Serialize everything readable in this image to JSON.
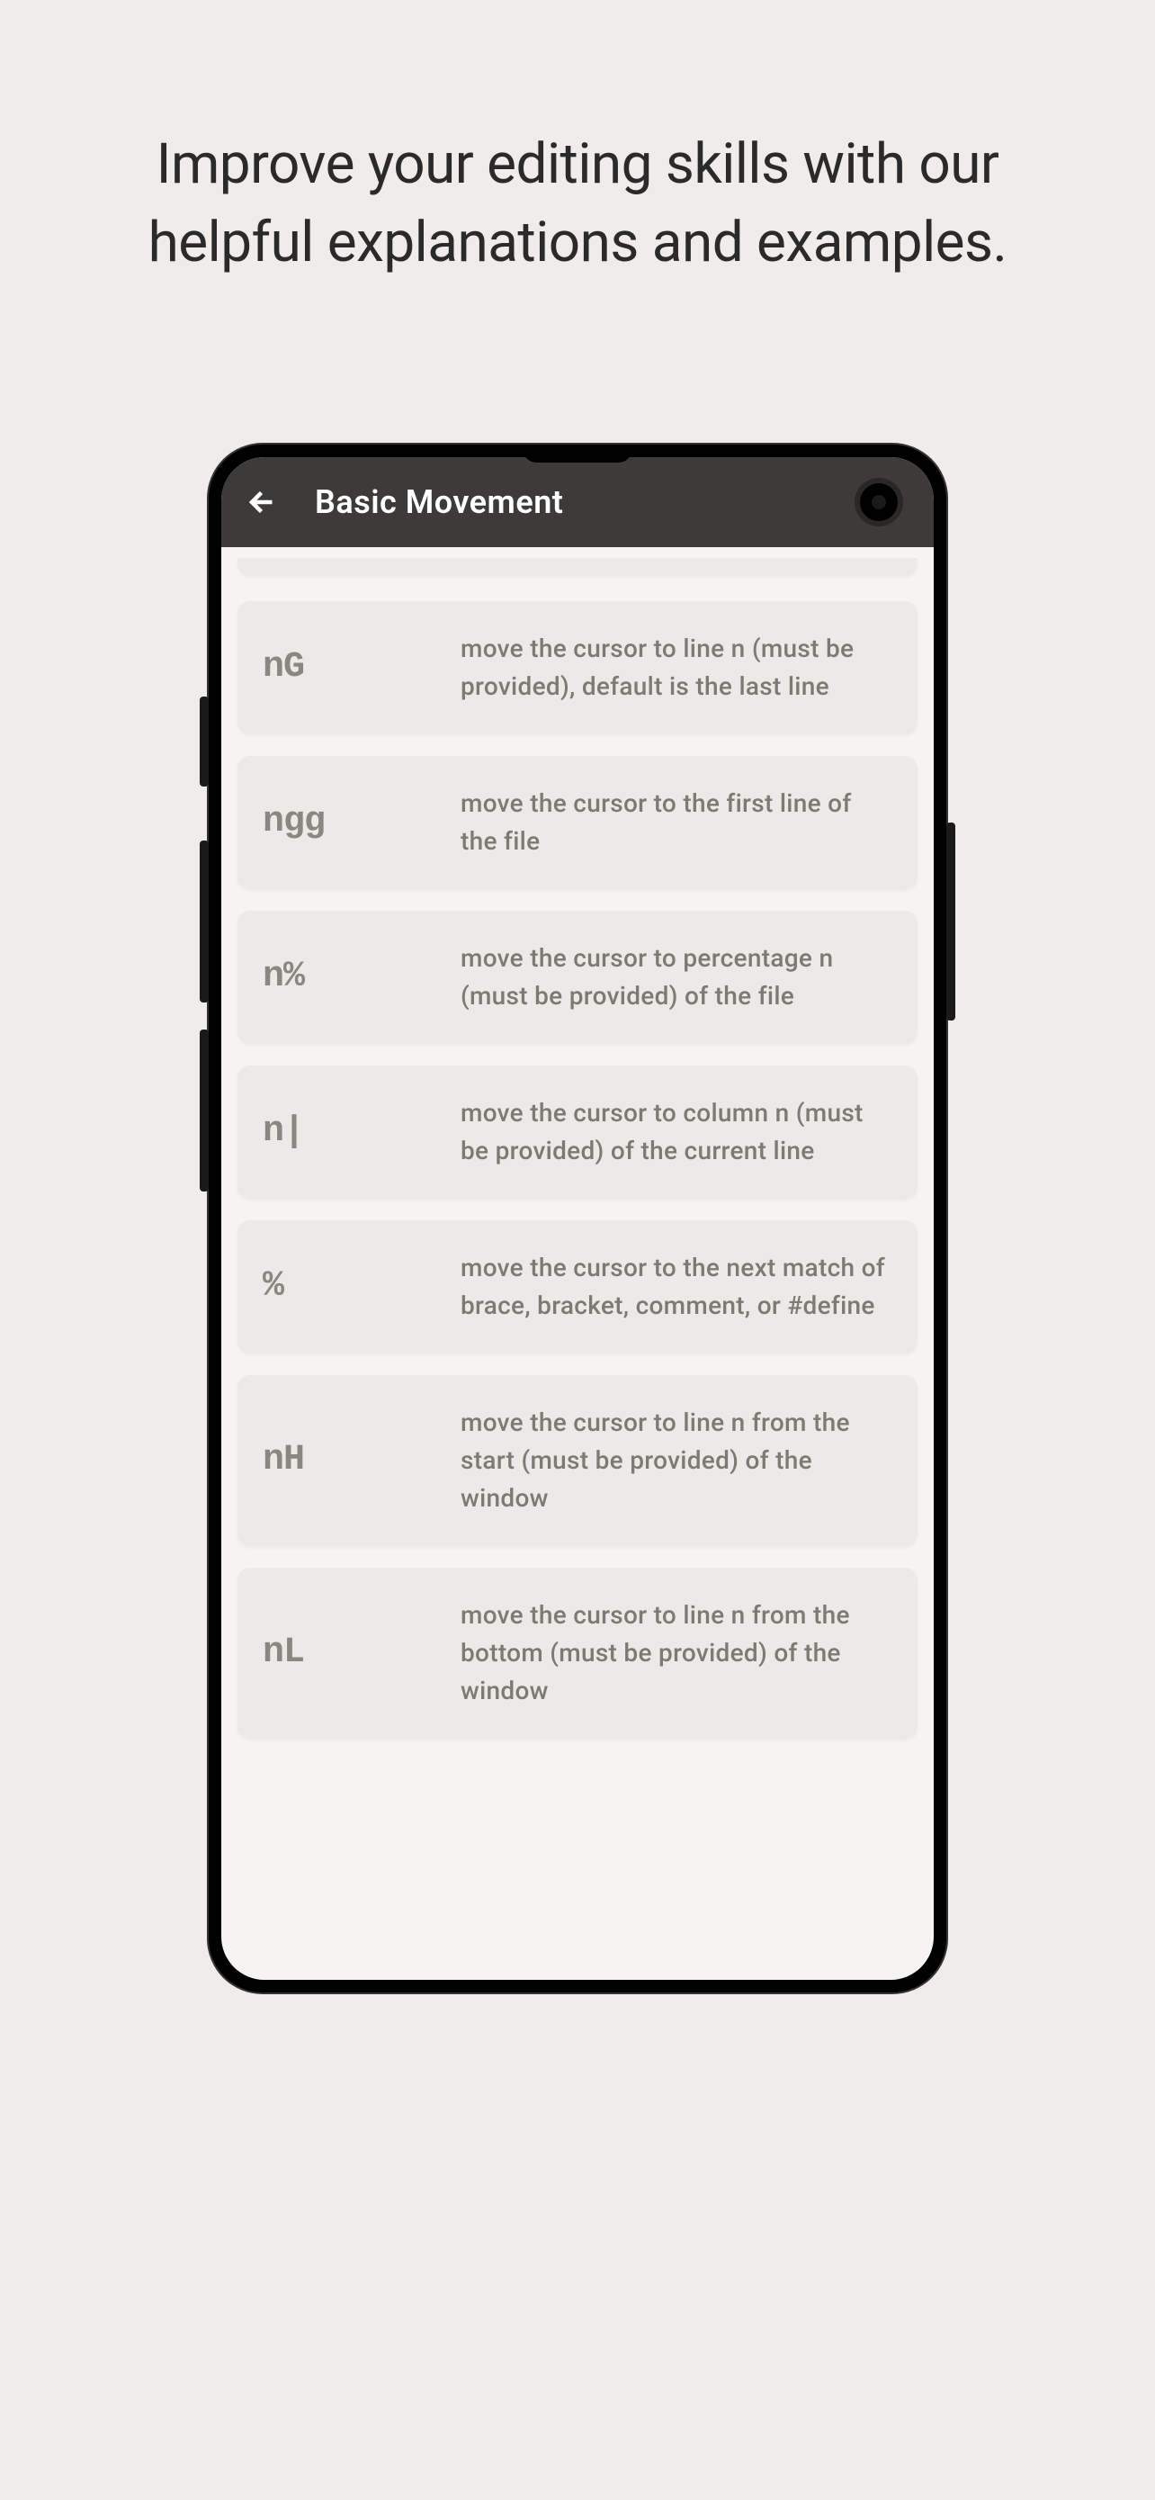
{
  "headline": "Improve your editing skills with our helpful explanations and examples.",
  "header": {
    "title": "Basic Movement"
  },
  "commands": [
    {
      "key": "nG",
      "description": "move the cursor to line n (must be provided), default is the last line"
    },
    {
      "key": "ngg",
      "description": "move the cursor to the first line of the file"
    },
    {
      "key": "n%",
      "description": "move the cursor to percentage n (must be provided) of the file"
    },
    {
      "key": "n|",
      "description": "move the cursor to column n (must be provided) of the current line"
    },
    {
      "key": "%",
      "description": "move the cursor to the next match of brace, bracket, comment, or #define"
    },
    {
      "key": "nH",
      "description": "move the cursor to line n from the start (must be provided) of the window"
    },
    {
      "key": "nL",
      "description": "move the cursor to line n from the bottom (must be provided) of the window"
    }
  ]
}
